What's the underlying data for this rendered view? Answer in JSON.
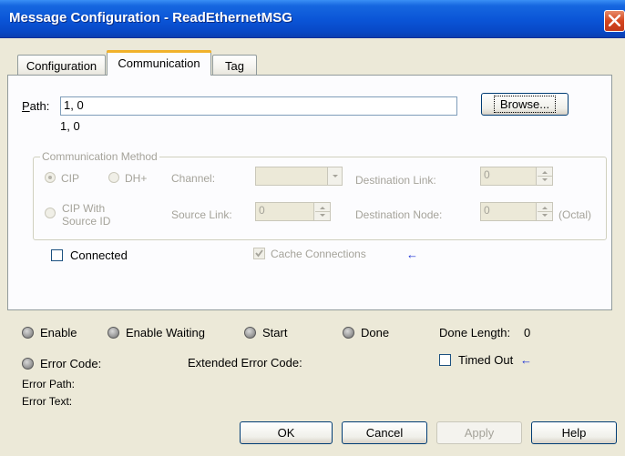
{
  "window": {
    "title": "Message Configuration - ReadEthernetMSG"
  },
  "tabs": [
    {
      "label": "Configuration",
      "active": false
    },
    {
      "label": "Communication",
      "active": true
    },
    {
      "label": "Tag",
      "active": false
    }
  ],
  "path": {
    "label": "Path:",
    "value": "1, 0",
    "resolved": "1, 0",
    "browse_label": "Browse..."
  },
  "comm_method": {
    "legend": "Communication Method",
    "cip_label": "CIP",
    "dhplus_label": "DH+",
    "channel_label": "Channel:",
    "destination_link_label": "Destination Link:",
    "destination_link_value": "0",
    "cip_with_source_line1": "CIP With",
    "cip_with_source_line2": "Source ID",
    "source_link_label": "Source Link:",
    "source_link_value": "0",
    "destination_node_label": "Destination Node:",
    "destination_node_value": "0",
    "octal_label": "(Octal)"
  },
  "connected": {
    "label": "Connected",
    "checked": false
  },
  "cache_connections": {
    "label": "Cache Connections",
    "checked": true,
    "arrow": "←"
  },
  "status": {
    "enable": "Enable",
    "enable_waiting": "Enable Waiting",
    "start": "Start",
    "done": "Done",
    "done_length_label": "Done Length:",
    "done_length_value": "0",
    "error_code": "Error Code:",
    "extended_error_code": "Extended Error Code:",
    "timed_out": "Timed Out",
    "timed_out_arrow": "←",
    "error_path": "Error Path:",
    "error_text": "Error Text:"
  },
  "buttons": {
    "ok": "OK",
    "cancel": "Cancel",
    "apply": "Apply",
    "help": "Help"
  },
  "colors": {
    "titlebar": "#0a54d6",
    "close": "#d5461e",
    "dialog_bg": "#ece9d8",
    "arrow": "#1a2fd6"
  }
}
